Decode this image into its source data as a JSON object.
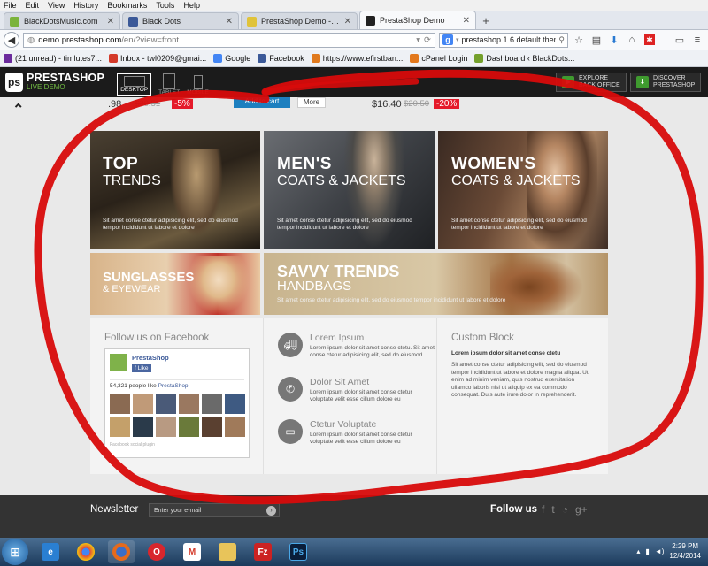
{
  "browser": {
    "menu": [
      "File",
      "Edit",
      "View",
      "History",
      "Bookmarks",
      "Tools",
      "Help"
    ],
    "tabs": [
      {
        "label": "BlackDotsMusic.com",
        "active": false
      },
      {
        "label": "Black Dots",
        "active": false
      },
      {
        "label": "PrestaShop Demo - Explore...",
        "active": false
      },
      {
        "label": "PrestaShop Demo",
        "active": true
      }
    ],
    "url_host": "demo.prestashop.com",
    "url_path": "/en/?view=front",
    "search_value": "prestashop 1.6 default theme",
    "bookmarks": [
      "(21 unread) - timlutes7...",
      "Inbox - twl0209@gmai...",
      "Google",
      "Facebook",
      "https://www.efirstban...",
      "cPanel Login",
      "Dashboard ‹ BlackDots..."
    ]
  },
  "demo_bar": {
    "logo_title": "PRESTASHOP",
    "logo_sub": "LIVE DEMO",
    "devices": [
      "DESKTOP",
      "TABLET",
      "MOBILE"
    ],
    "btn1": [
      "EXPLORE",
      "BACK OFFICE"
    ],
    "btn2": [
      "DISCOVER",
      "PRESTASHOP"
    ]
  },
  "products_row": {
    "p1_price": ".98",
    "p1_old": "$30.51",
    "p1_disc": "-5%",
    "add_to_cart": "Add to cart",
    "more": "More",
    "p2_price": "$16.40",
    "p2_old": "$20.50",
    "p2_disc": "-20%"
  },
  "banners": [
    {
      "title": "TOP",
      "subtitle": "TRENDS",
      "text": "Sit amet conse ctetur adipisicing elit, sed do eiusmod tempor incididunt ut labore et dolore"
    },
    {
      "title": "MEN'S",
      "subtitle": "COATS & JACKETS",
      "text": "Sit amet conse ctetur adipisicing elit, sed do eiusmod tempor incididunt ut labore et dolore"
    },
    {
      "title": "WOMEN'S",
      "subtitle": "COATS & JACKETS",
      "text": "Sit amet conse ctetur adipisicing elit, sed do eiusmod tempor incididunt ut labore et dolore"
    },
    {
      "title": "SUNGLASSES",
      "subtitle": "& EYEWEAR",
      "text": ""
    },
    {
      "title": "SAVVY TRENDS",
      "subtitle": "HANDBAGS",
      "text": "Sit amet conse ctetur adipisicing elit, sed do eiusmod tempor incididunt ut labore et dolore"
    }
  ],
  "facebook": {
    "heading": "Follow us on Facebook",
    "page_name": "PrestaShop",
    "like": "Like",
    "count_text": "54,321 people like",
    "count_link": "PrestaShop.",
    "footer": "Facebook social plugin"
  },
  "features": [
    {
      "title": "Lorem Ipsum",
      "text": "Lorem ipsum dolor sit amet conse ctetu. Sit amet conse ctetur adipisicing elit, sed do eiusmod tempor incididunt ut labore et dolore eu",
      "icon": "truck-icon"
    },
    {
      "title": "Dolor Sit Amet",
      "text": "Lorem ipsum dolor sit amet conse ctetur voluptate velit esse cillum dolore eu",
      "icon": "phone-icon"
    },
    {
      "title": "Ctetur Voluptate",
      "text": "Lorem ipsum dolor sit amet conse ctetur voluptate velit esse cillum dolore eu",
      "icon": "card-icon"
    }
  ],
  "custom_block": {
    "heading": "Custom Block",
    "subheading": "Lorem ipsum dolor sit amet conse ctetu",
    "text": "Sit amet conse ctetur adipisicing elit, sed do eiusmod tempor incididunt ut labore et dolore magna aliqua. Ut enim ad minim veniam, quis nostrud exercitation ullamco laboris nisi ut aliquip ex ea commodo consequat. Duis aute irure dolor in reprehenderit."
  },
  "footer": {
    "newsletter_label": "Newsletter",
    "newsletter_placeholder": "Enter your e-mail",
    "follow_label": "Follow us"
  },
  "taskbar": {
    "time": "2:29 PM",
    "date": "12/4/2014"
  },
  "colors": {
    "annotation_red": "#d80b0b",
    "discount_red": "#e51a2a",
    "ps_green": "#74c044",
    "cart_blue": "#1d7fbf"
  }
}
